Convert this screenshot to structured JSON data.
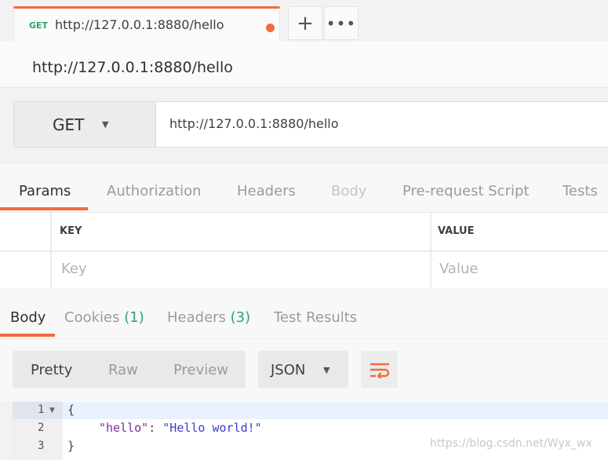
{
  "tab": {
    "method": "GET",
    "url": "http://127.0.0.1:8880/hello"
  },
  "tab_actions": {
    "plus": "+",
    "more": "•••"
  },
  "request": {
    "name": "http://127.0.0.1:8880/hello",
    "method": "GET",
    "url": "http://127.0.0.1:8880/hello"
  },
  "request_tabs": [
    "Params",
    "Authorization",
    "Headers",
    "Body",
    "Pre-request Script",
    "Tests"
  ],
  "params_table": {
    "headers": [
      "KEY",
      "VALUE"
    ],
    "placeholders": [
      "Key",
      "Value"
    ]
  },
  "response_tabs": {
    "body": "Body",
    "cookies": "Cookies",
    "cookies_count": "(1)",
    "headers": "Headers",
    "headers_count": "(3)",
    "test_results": "Test Results"
  },
  "view_modes": [
    "Pretty",
    "Raw",
    "Preview"
  ],
  "language": "JSON",
  "code": {
    "line_numbers": [
      "1",
      "2",
      "3"
    ],
    "line1": "{",
    "key": "\"hello\"",
    "colon": ": ",
    "value": "\"Hello world!\"",
    "line3": "}"
  },
  "watermark": "https://blog.csdn.net/Wyx_wx",
  "colors": {
    "accent": "#f26b3a",
    "get_method": "#2fa26f",
    "count": "#2fa26f"
  }
}
